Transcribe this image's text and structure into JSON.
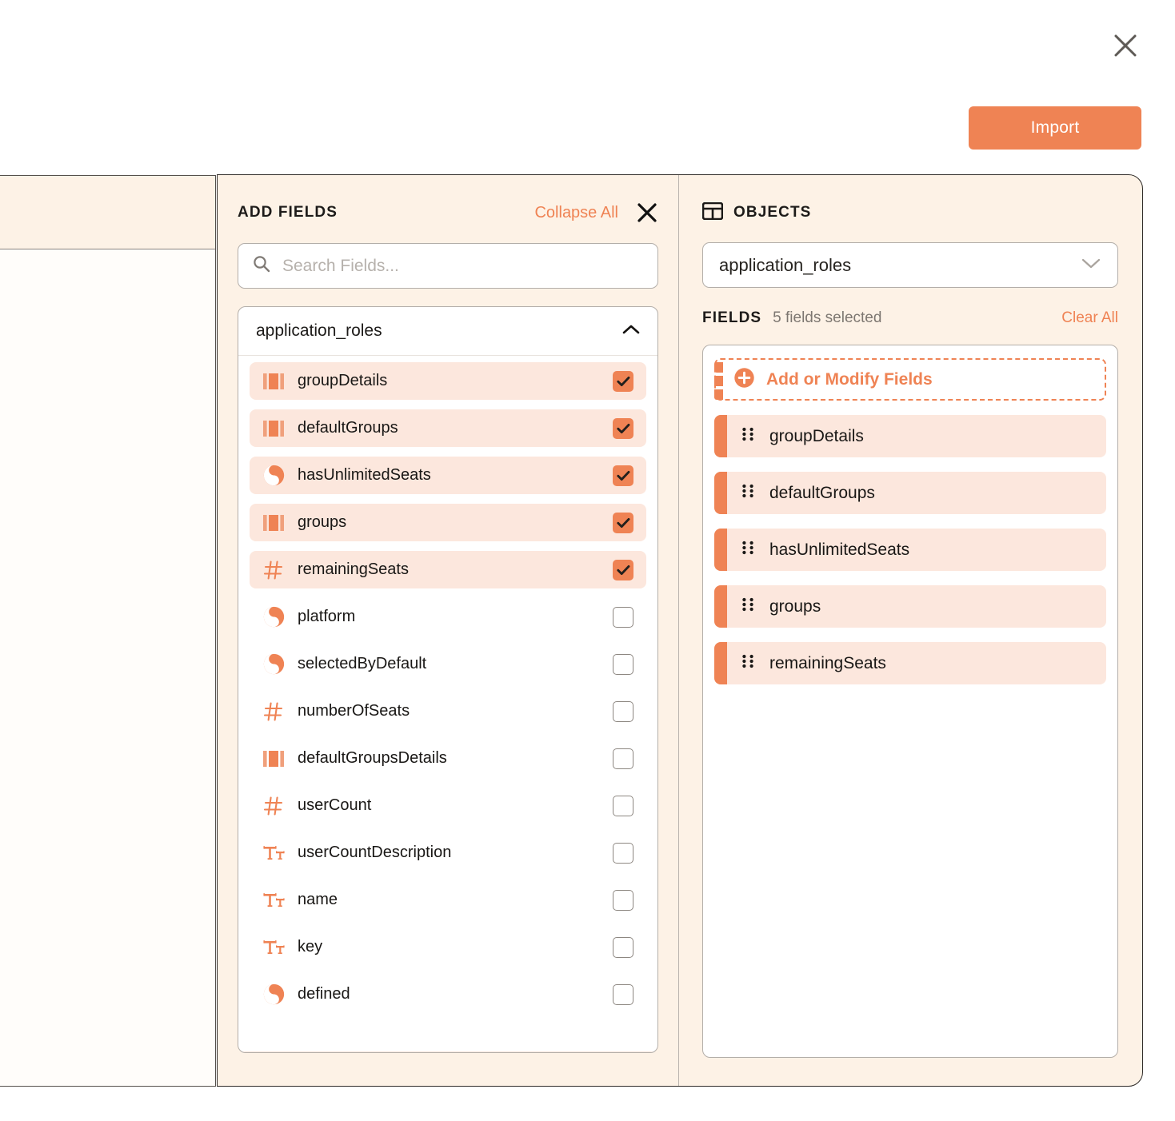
{
  "topbar": {
    "close_icon": "close-icon",
    "import_label": "Import"
  },
  "colors": {
    "accent": "#ef8354",
    "panel_bg": "#fdf2e6",
    "chip_bg": "#fce7dd",
    "text": "#191715"
  },
  "add_fields": {
    "title": "ADD FIELDS",
    "collapse_all_label": "Collapse All",
    "close_icon": "close-icon",
    "search": {
      "placeholder": "Search Fields...",
      "value": "",
      "icon": "search-icon"
    },
    "group": {
      "name": "application_roles",
      "chevron_icon": "chevron-up-icon",
      "expanded": true
    },
    "fields": [
      {
        "label": "groupDetails",
        "type": "array",
        "checked": true
      },
      {
        "label": "defaultGroups",
        "type": "array",
        "checked": true
      },
      {
        "label": "hasUnlimitedSeats",
        "type": "boolean",
        "checked": true
      },
      {
        "label": "groups",
        "type": "array",
        "checked": true
      },
      {
        "label": "remainingSeats",
        "type": "number",
        "checked": true
      },
      {
        "label": "platform",
        "type": "boolean",
        "checked": false
      },
      {
        "label": "selectedByDefault",
        "type": "boolean",
        "checked": false
      },
      {
        "label": "numberOfSeats",
        "type": "number",
        "checked": false
      },
      {
        "label": "defaultGroupsDetails",
        "type": "array",
        "checked": false
      },
      {
        "label": "userCount",
        "type": "number",
        "checked": false
      },
      {
        "label": "userCountDescription",
        "type": "text",
        "checked": false
      },
      {
        "label": "name",
        "type": "text",
        "checked": false
      },
      {
        "label": "key",
        "type": "text",
        "checked": false
      },
      {
        "label": "defined",
        "type": "boolean",
        "checked": false
      }
    ]
  },
  "objects": {
    "title": "OBJECTS",
    "icon": "table-icon",
    "selected_object": "application_roles",
    "select_chevron_icon": "chevron-down-icon",
    "fields_label": "FIELDS",
    "fields_count_text": "5 fields selected",
    "clear_all_label": "Clear All",
    "add_or_modify_label": "Add or Modify Fields",
    "add_icon": "plus-circle-icon",
    "selected_fields": [
      {
        "label": "groupDetails",
        "handle_icon": "drag-handle-icon"
      },
      {
        "label": "defaultGroups",
        "handle_icon": "drag-handle-icon"
      },
      {
        "label": "hasUnlimitedSeats",
        "handle_icon": "drag-handle-icon"
      },
      {
        "label": "groups",
        "handle_icon": "drag-handle-icon"
      },
      {
        "label": "remainingSeats",
        "handle_icon": "drag-handle-icon"
      }
    ]
  }
}
